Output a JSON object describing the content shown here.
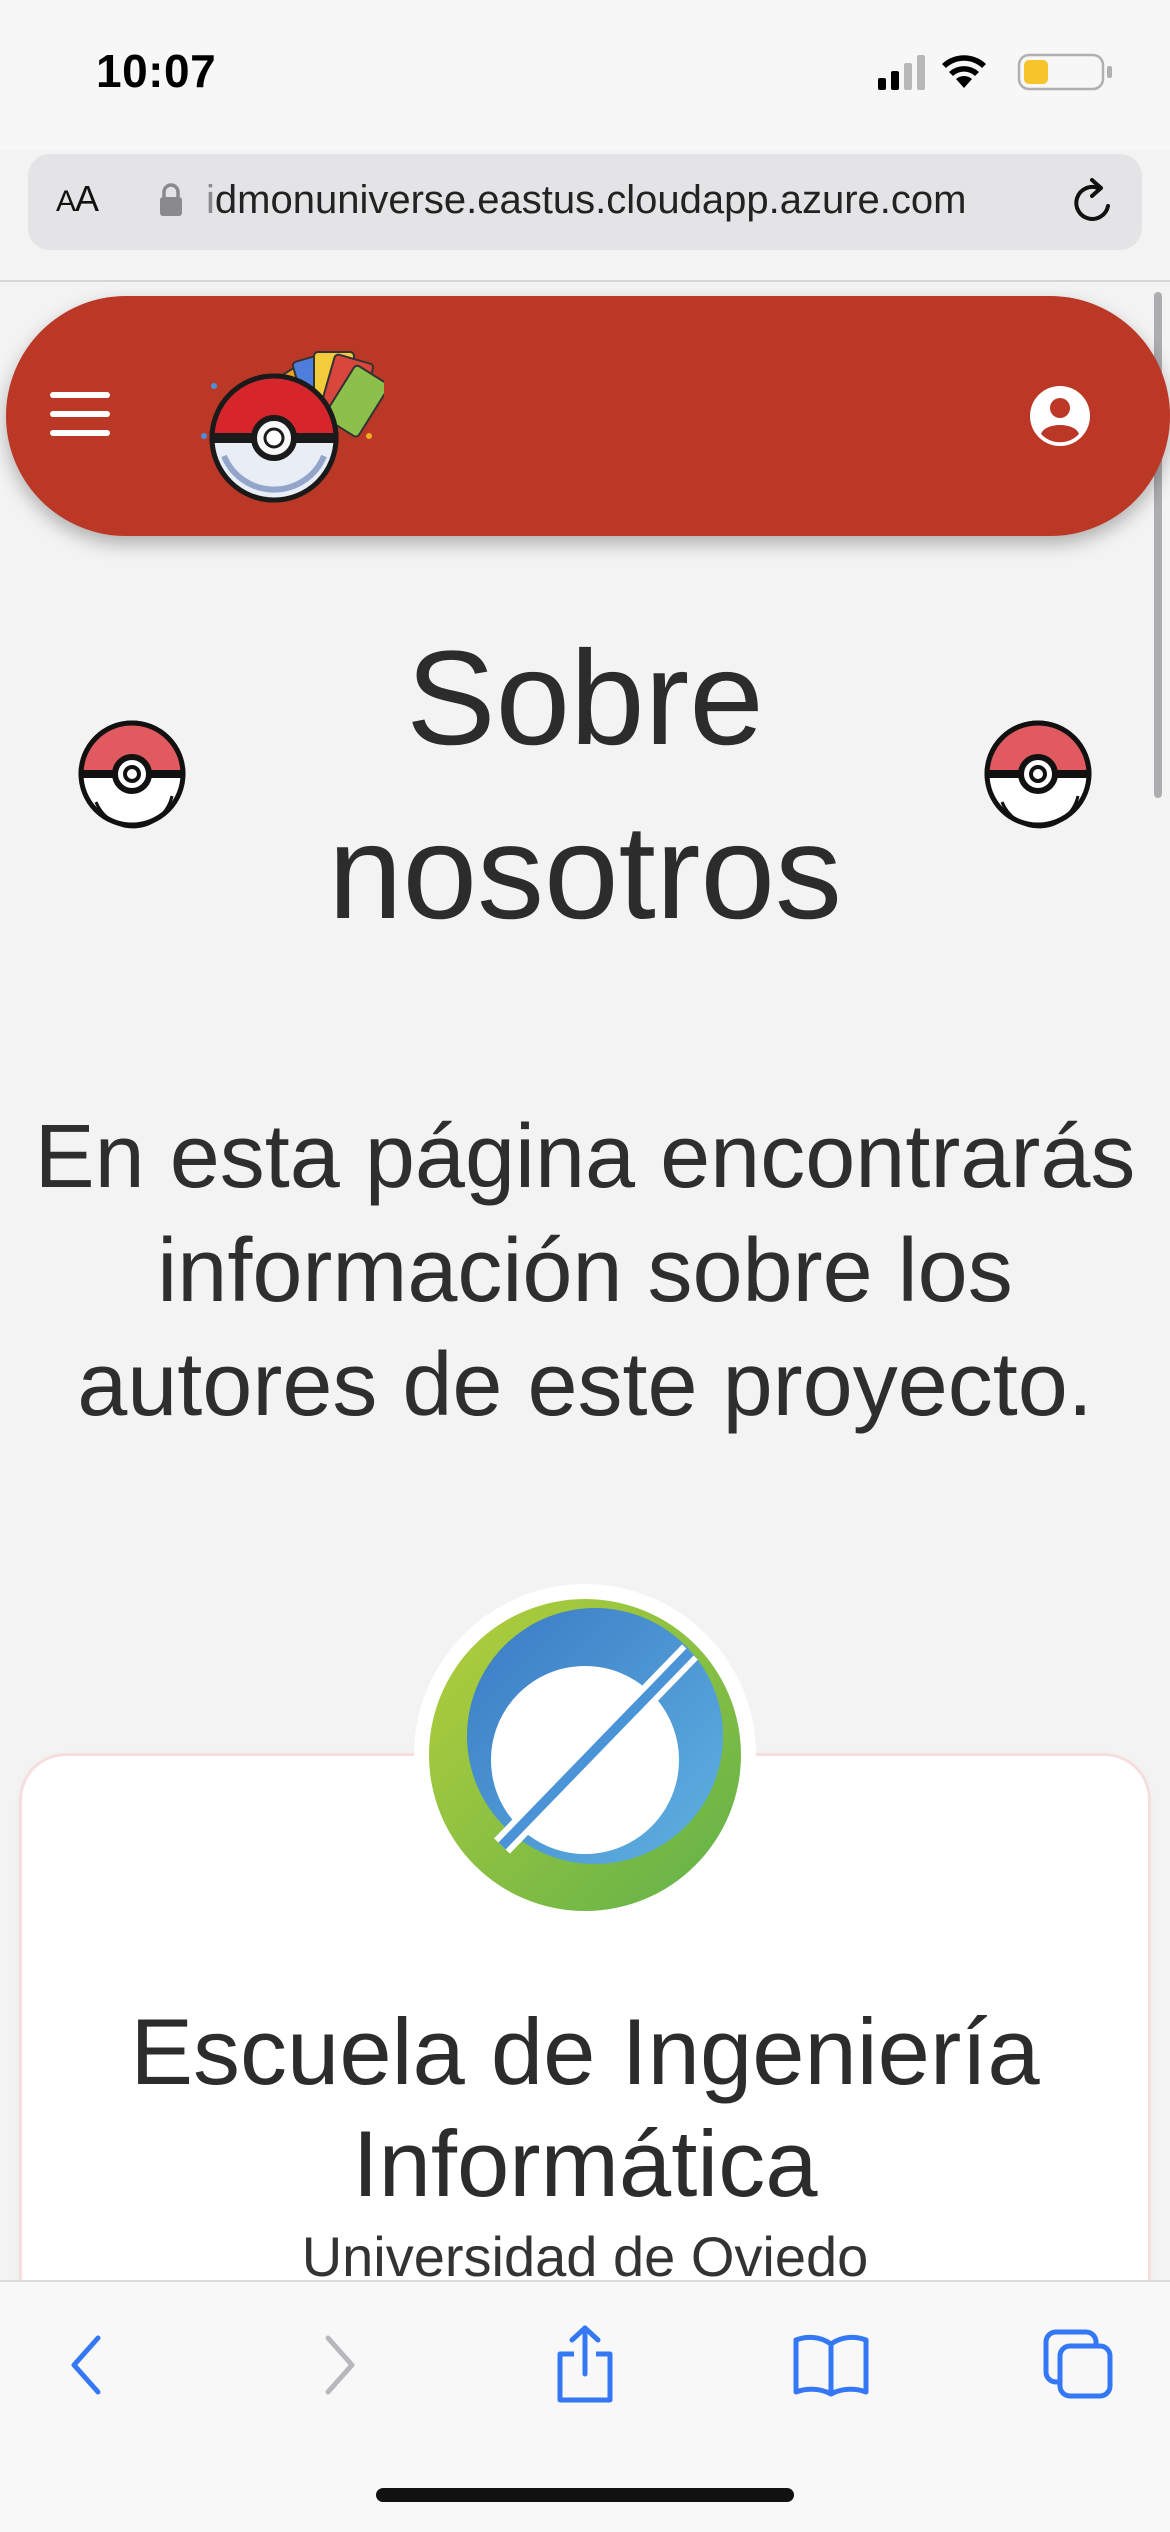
{
  "status_bar": {
    "time": "10:07"
  },
  "browser": {
    "aa_label_small": "A",
    "aa_label_large": "A",
    "url_first_char": "i",
    "url_rest": "dmonuniverse.eastus.cloudapp.azure.com"
  },
  "colors": {
    "header_red": "#bb3826",
    "ios_blue": "#3478f6"
  },
  "header": {
    "menu_icon": "hamburger-icon",
    "logo_icon": "pokeball-cards-logo",
    "account_icon": "account-circle-icon"
  },
  "hero": {
    "title": "Sobre nosotros",
    "decor_icon": "pokeball-icon"
  },
  "intro": {
    "text": "En esta página encontrarás información sobre los autores de este proyecto."
  },
  "school": {
    "name": "Escuela de Ingeniería Informática",
    "university": "Universidad de Oviedo",
    "logo_icon": "school-logo"
  },
  "toolbar": {
    "back_icon": "chevron-left-icon",
    "forward_icon": "chevron-right-icon",
    "share_icon": "share-icon",
    "bookmarks_icon": "book-icon",
    "tabs_icon": "tabs-icon"
  }
}
